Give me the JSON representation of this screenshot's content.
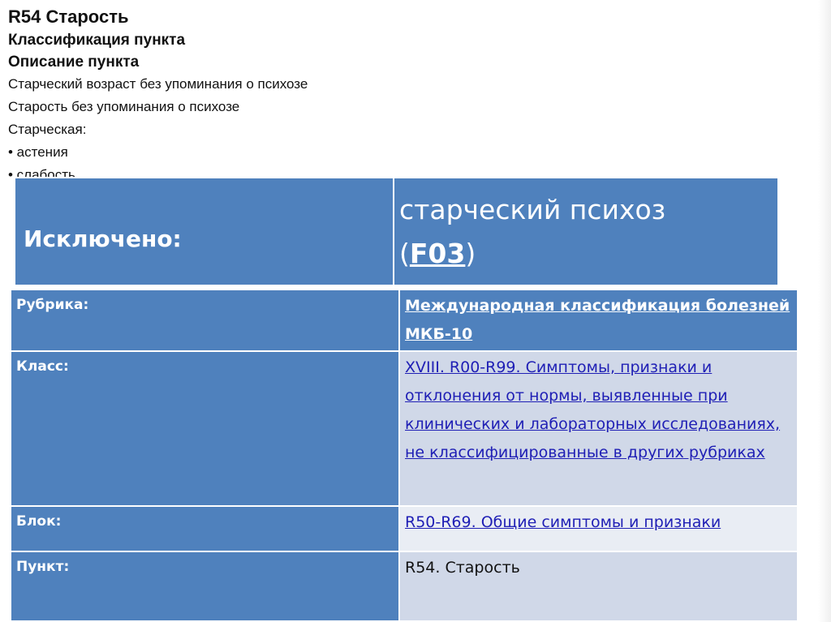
{
  "header": {
    "title": "R54 Старость",
    "classification": "Классификация пункта",
    "description_heading": "Описание пункта",
    "lines": [
      "Старческий возраст без упоминания о психозе",
      "Старость без упоминания о психозе",
      "Старческая:"
    ],
    "bullets": [
      "• астения",
      "• слабость"
    ]
  },
  "exclusion": {
    "label": "Исключено:",
    "value_text": "старческий психоз",
    "value_open": "(",
    "value_link": "F03",
    "value_close": ")"
  },
  "info": {
    "rows": [
      {
        "key": "Рубрика:",
        "value": "Международная классификация болезней МКБ-10"
      },
      {
        "key": "Класс:",
        "value": "XVIII. R00-R99. Симптомы, признаки и отклонения от нормы, выявленные при клинических и лабораторных исследованиях, не классифицированные в других рубриках"
      },
      {
        "key": "Блок:",
        "value": "R50-R69. Общие симптомы и признаки"
      },
      {
        "key": "Пункт:",
        "value": "R54. Старость"
      }
    ]
  },
  "colors": {
    "header_blue": "#4f81bd",
    "row_light": "#d0d8e8",
    "row_lighter": "#e9edf4",
    "link": "#1f1fb5"
  }
}
